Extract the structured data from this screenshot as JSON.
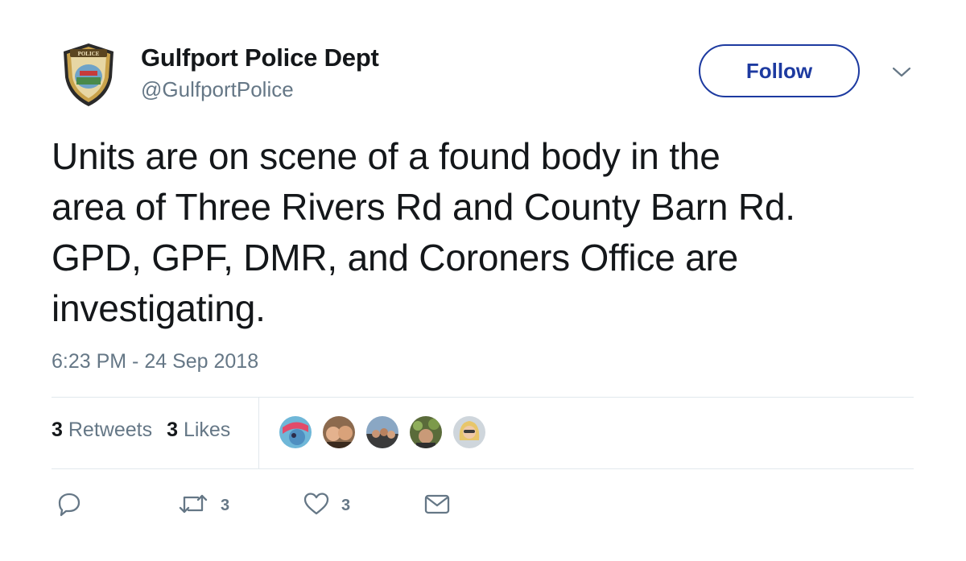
{
  "author": {
    "name": "Gulfport Police Dept",
    "handle": "@GulfportPolice",
    "avatar_badge_text": "POLICE"
  },
  "header": {
    "follow_label": "Follow"
  },
  "tweet": {
    "lines": [
      "Units are on scene of a found body in the",
      "area of Three Rivers Rd and County Barn Rd.",
      "GPD, GPF, DMR, and Coroners Office are",
      "investigating."
    ],
    "timestamp": "6:23 PM - 24 Sep 2018"
  },
  "stats": {
    "retweets_count": "3",
    "retweets_label": "Retweets",
    "likes_count": "3",
    "likes_label": "Likes"
  },
  "actions": {
    "reply_icon": "speech-bubble",
    "retweet_icon": "retweet-arrows",
    "retweet_count": "3",
    "like_icon": "heart",
    "like_count": "3",
    "dm_icon": "envelope"
  },
  "colors": {
    "follow_accent": "#1d3aa0",
    "secondary_text": "#657786",
    "primary_text": "#14171a",
    "divider": "#e1e8ed"
  }
}
